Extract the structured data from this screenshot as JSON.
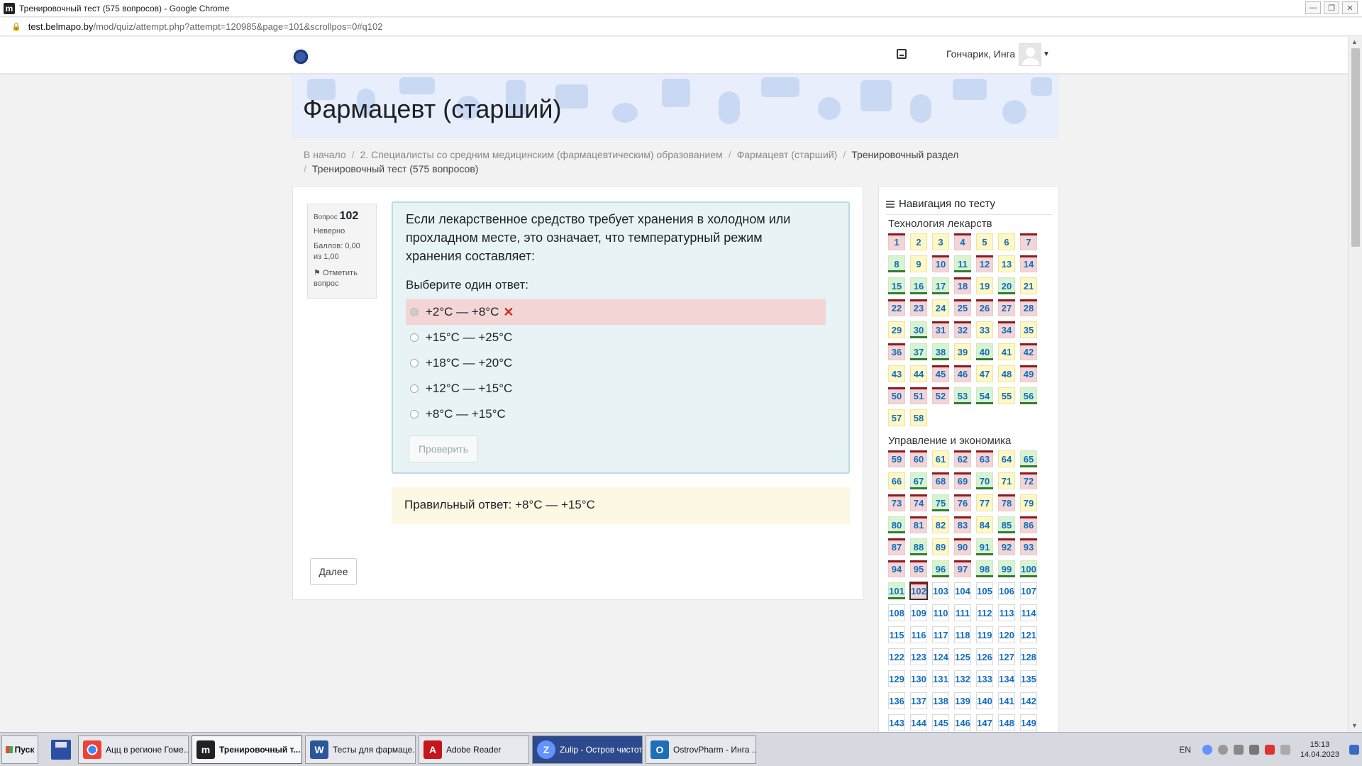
{
  "window": {
    "title": "Тренировочный тест (575 вопросов) - Google Chrome",
    "url_host": "test.belmapo.by",
    "url_path": "/mod/quiz/attempt.php?attempt=120985&page=101&scrollpos=0#q102"
  },
  "navbar": {
    "username": "Гончарик, Инга"
  },
  "banner": {
    "title": "Фармацевт (старший)"
  },
  "breadcrumb": {
    "items": [
      "В начало",
      "2. Специалисты со средним медицинским (фармацевтическим) образованием",
      "Фармацевт (старший)",
      "Тренировочный раздел",
      "Тренировочный тест (575 вопросов)"
    ]
  },
  "question": {
    "label": "Вопрос",
    "number": "102",
    "state": "Неверно",
    "grade": "Баллов: 0,00 из 1,00",
    "flag_label": "Отметить вопрос",
    "text": "Если лекарственное средство требует хранения в холодном или прохладном месте, это означает, что температурный режим хранения составляет:",
    "prompt": "Выберите один ответ:",
    "answers": [
      "+2°C — +8°C",
      "+15°C — +25°C",
      "+18°C — +20°C",
      "+12°C — +15°C",
      "+8°C — +15°C"
    ],
    "selected_index": 0,
    "check_label": "Проверить",
    "correct_answer": "Правильный ответ: +8°C — +15°C",
    "next_label": "Далее"
  },
  "navigation": {
    "title": "Навигация по тесту",
    "sections": [
      {
        "title": "Технология лекарств",
        "start": 1,
        "states": "iipiippcicippicccipcipiiiiipcipipccipcppi iiipppiipppc"
      },
      {
        "title": "Управление и экономика",
        "start": 59,
        "states": ""
      }
    ],
    "current": 102,
    "last_visible": 149
  },
  "question_states": {
    "1": "i",
    "2": "p",
    "3": "p",
    "4": "i",
    "5": "p",
    "6": "p",
    "7": "i",
    "8": "c",
    "9": "p",
    "10": "i",
    "11": "c",
    "12": "i",
    "13": "p",
    "14": "i",
    "15": "c",
    "16": "c",
    "17": "c",
    "18": "i",
    "19": "p",
    "20": "c",
    "21": "p",
    "22": "i",
    "23": "i",
    "24": "p",
    "25": "i",
    "26": "i",
    "27": "i",
    "28": "i",
    "29": "p",
    "30": "c",
    "31": "i",
    "32": "i",
    "33": "p",
    "34": "i",
    "35": "p",
    "36": "i",
    "37": "c",
    "38": "c",
    "39": "p",
    "40": "c",
    "41": "p",
    "42": "i",
    "43": "p",
    "44": "p",
    "45": "i",
    "46": "i",
    "47": "p",
    "48": "p",
    "49": "i",
    "50": "i",
    "51": "i",
    "52": "i",
    "53": "c",
    "54": "c",
    "55": "p",
    "56": "c",
    "57": "p",
    "58": "p",
    "59": "i",
    "60": "i",
    "61": "p",
    "62": "i",
    "63": "i",
    "64": "p",
    "65": "c",
    "66": "p",
    "67": "c",
    "68": "i",
    "69": "i",
    "70": "c",
    "71": "p",
    "72": "i",
    "73": "i",
    "74": "i",
    "75": "c",
    "76": "i",
    "77": "p",
    "78": "i",
    "79": "p",
    "80": "c",
    "81": "i",
    "82": "p",
    "83": "i",
    "84": "p",
    "85": "c",
    "86": "i",
    "87": "i",
    "88": "c",
    "89": "p",
    "90": "i",
    "91": "c",
    "92": "i",
    "93": "i",
    "94": "i",
    "95": "i",
    "96": "c",
    "97": "i",
    "98": "c",
    "99": "c",
    "100": "c",
    "101": "c",
    "102": "i"
  },
  "taskbar": {
    "start": "Пуск",
    "tasks": [
      {
        "label": "Ацц в регионе Гоме...",
        "color": "#ffffff"
      },
      {
        "label": "Тренировочный т...",
        "color": "#222222"
      },
      {
        "label": "Тесты для фармаце...",
        "color": "#2b579a"
      },
      {
        "label": "Adobe Reader",
        "color": "#c4161c"
      },
      {
        "label": "Zulip - Остров чистоты",
        "color": "#6492fe"
      },
      {
        "label": "OstrovPharm - Инга ...",
        "color": "#1d6fb8"
      }
    ],
    "lang": "EN",
    "time": "15:13",
    "date": "14.04.2023"
  }
}
